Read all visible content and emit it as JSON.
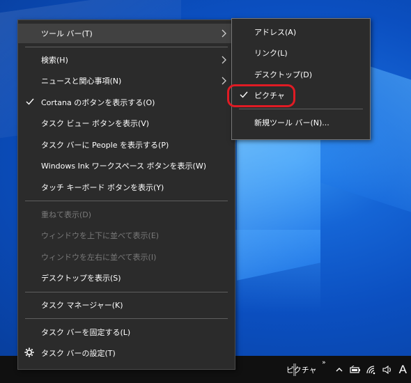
{
  "context_menu": {
    "items": [
      {
        "label": "ツール バー(T)",
        "submenu": true,
        "hover": true
      },
      {
        "label": "検索(H)",
        "submenu": true
      },
      {
        "label": "ニュースと関心事項(N)",
        "submenu": true
      },
      {
        "label": "Cortana のボタンを表示する(O)",
        "checked": true
      },
      {
        "label": "タスク ビュー ボタンを表示(V)"
      },
      {
        "label": "タスク バーに People を表示する(P)"
      },
      {
        "label": "Windows Ink ワークスペース ボタンを表示(W)"
      },
      {
        "label": "タッチ キーボード ボタンを表示(Y)"
      },
      {
        "label": "重ねて表示(D)",
        "disabled": true
      },
      {
        "label": "ウィンドウを上下に並べて表示(E)",
        "disabled": true
      },
      {
        "label": "ウィンドウを左右に並べて表示(I)",
        "disabled": true
      },
      {
        "label": "デスクトップを表示(S)"
      },
      {
        "label": "タスク マネージャー(K)"
      },
      {
        "label": "タスク バーを固定する(L)"
      },
      {
        "label": "タスク バーの設定(T)",
        "icon": "gear-icon"
      }
    ]
  },
  "toolbar_submenu": {
    "items": [
      {
        "label": "アドレス(A)"
      },
      {
        "label": "リンク(L)"
      },
      {
        "label": "デスクトップ(D)"
      },
      {
        "label": "ピクチャ",
        "checked": true,
        "highlighted": true
      },
      {
        "label": "新規ツール バー(N)..."
      }
    ]
  },
  "taskbar": {
    "toolbar_label": "ピクチャ",
    "overflow_glyph": "»",
    "ime_mode": "A",
    "tray_icons": [
      "chevron-up-icon",
      "battery-icon",
      "wifi-icon",
      "speaker-icon"
    ]
  },
  "colors": {
    "menu_bg": "#2b2b2b",
    "hover_bg": "#414141",
    "highlight_ring": "#e01b24",
    "taskbar_bg": "#101010"
  }
}
